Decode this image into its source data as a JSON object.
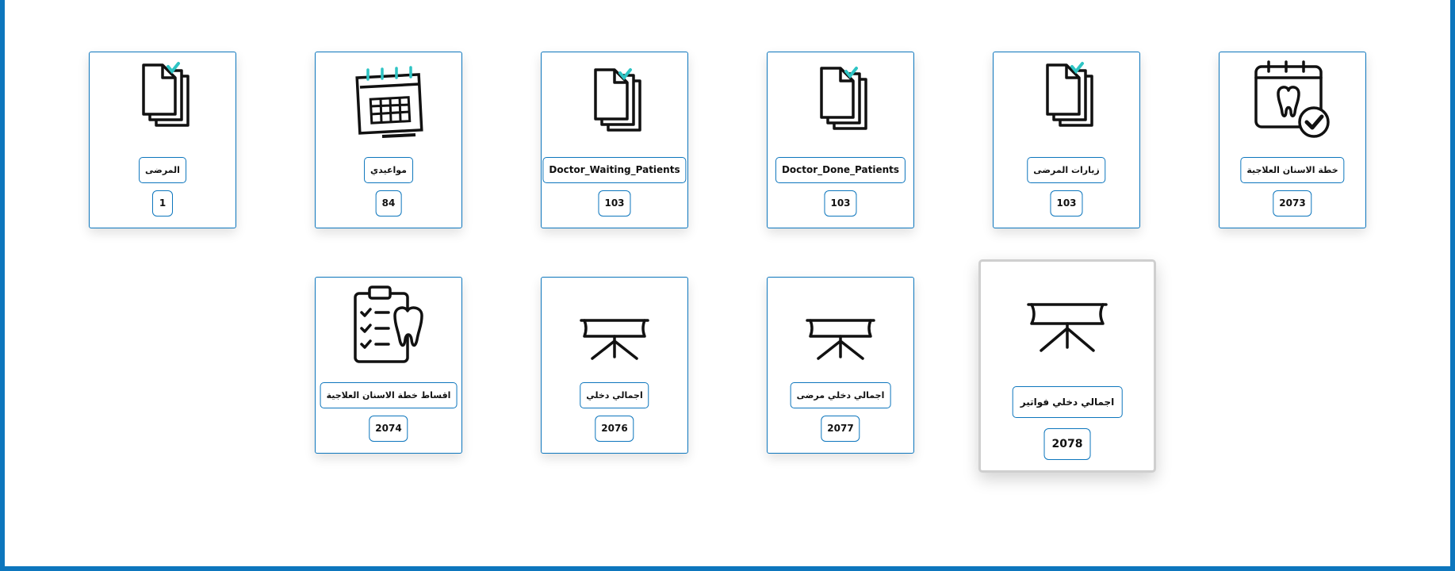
{
  "colors": {
    "accent": "#0d76bd",
    "check": "#2ec4c4"
  },
  "cards": [
    {
      "label": "المرضى",
      "count": "1",
      "icon": "documents-check-icon"
    },
    {
      "label": "مواعيدي",
      "count": "84",
      "icon": "calendar-icon"
    },
    {
      "label": "Doctor_Waiting_Patients",
      "count": "103",
      "icon": "documents-check-icon"
    },
    {
      "label": "Doctor_Done_Patients",
      "count": "103",
      "icon": "documents-check-icon"
    },
    {
      "label": "زيارات المرضى",
      "count": "103",
      "icon": "documents-check-icon"
    },
    {
      "label": "خطة الاسنان العلاجية",
      "count": "2073",
      "icon": "dental-calendar-icon"
    },
    {
      "label": "اقساط خطة الاسنان العلاجية",
      "count": "2074",
      "icon": "dental-clipboard-icon"
    },
    {
      "label": "اجمالي دخلي",
      "count": "2076",
      "icon": "presentation-board-icon"
    },
    {
      "label": "اجمالي دخلي مرضى",
      "count": "2077",
      "icon": "presentation-board-icon"
    },
    {
      "label": "اجمالي دخلي فواتير",
      "count": "2078",
      "icon": "presentation-board-icon"
    }
  ]
}
